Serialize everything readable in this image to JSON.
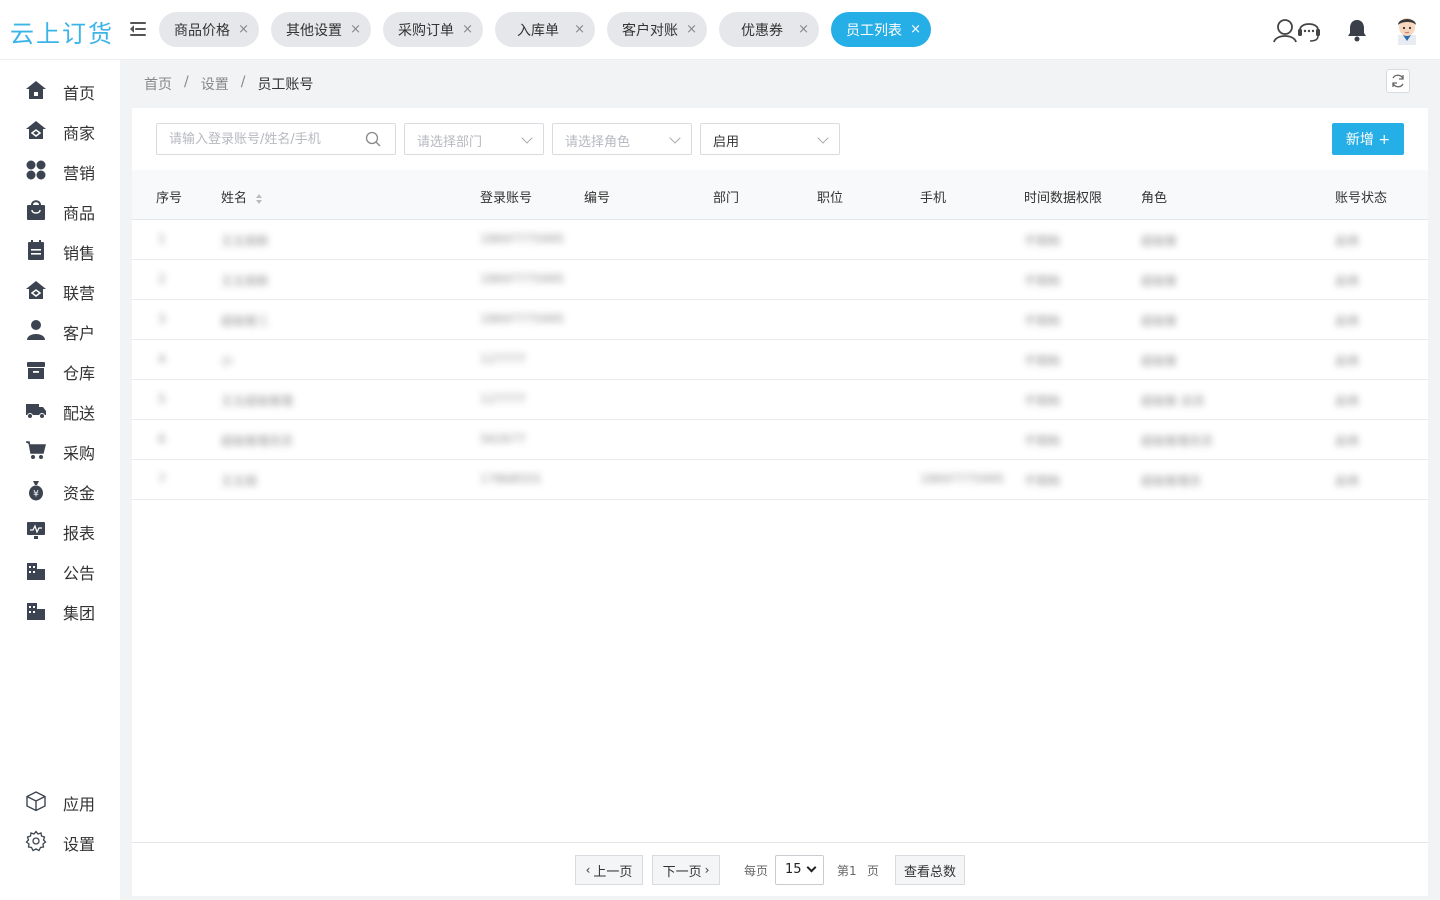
{
  "app": {
    "logo": "云上订货"
  },
  "tabs": [
    {
      "label": "商品价格",
      "close": "×",
      "active": false
    },
    {
      "label": "其他设置",
      "close": "×",
      "active": false
    },
    {
      "label": "采购订单",
      "close": "×",
      "active": false
    },
    {
      "label": "入库单",
      "close": "×",
      "active": false
    },
    {
      "label": "客户对账",
      "close": "×",
      "active": false
    },
    {
      "label": "优惠券",
      "close": "×",
      "active": false
    },
    {
      "label": "员工列表",
      "close": "×",
      "active": true
    }
  ],
  "header_icons": [
    "customer-service-icon",
    "bell-icon",
    "avatar"
  ],
  "sidebar": {
    "items": [
      {
        "label": "首页",
        "icon": "home-icon"
      },
      {
        "label": "商家",
        "icon": "store-icon"
      },
      {
        "label": "营销",
        "icon": "marketing-icon"
      },
      {
        "label": "商品",
        "icon": "goods-bag-icon"
      },
      {
        "label": "销售",
        "icon": "sales-calendar-icon"
      },
      {
        "label": "联营",
        "icon": "alliance-icon"
      },
      {
        "label": "客户",
        "icon": "customer-icon"
      },
      {
        "label": "仓库",
        "icon": "warehouse-icon"
      },
      {
        "label": "配送",
        "icon": "truck-icon"
      },
      {
        "label": "采购",
        "icon": "cart-icon"
      },
      {
        "label": "资金",
        "icon": "money-bag-icon"
      },
      {
        "label": "报表",
        "icon": "report-icon"
      },
      {
        "label": "公告",
        "icon": "announcement-icon"
      },
      {
        "label": "集团",
        "icon": "group-building-icon"
      }
    ],
    "bottom": [
      {
        "label": "应用",
        "icon": "cube-icon"
      },
      {
        "label": "设置",
        "icon": "gear-icon"
      }
    ]
  },
  "breadcrumb": {
    "home": "首页",
    "sep": "/",
    "level2": "设置",
    "current": "员工账号"
  },
  "filters": {
    "search_placeholder": "请输入登录账号/姓名/手机",
    "department_placeholder": "请选择部门",
    "role_placeholder": "请选择角色",
    "status_value": "启用"
  },
  "add_button": "新增 +",
  "table": {
    "headers": {
      "index": "序号",
      "name": "姓名",
      "account": "登录账号",
      "code": "编号",
      "department": "部门",
      "position": "职位",
      "phone": "手机",
      "time_permission": "时间数据权限",
      "role": "角色",
      "status": "账号状态"
    },
    "rows": [
      {
        "index": "1",
        "name": "王五丽新",
        "account": "18697775995",
        "code": "",
        "department": "",
        "position": "",
        "phone": "",
        "time_permission": "不限制",
        "role": "超级管",
        "status": "启用"
      },
      {
        "index": "2",
        "name": "王五丽新",
        "account": "18697775995",
        "code": "",
        "department": "",
        "position": "",
        "phone": "",
        "time_permission": "不限制",
        "role": "超级管",
        "status": "启用"
      },
      {
        "index": "3",
        "name": "超级管三",
        "account": "18697775995",
        "code": "",
        "department": "",
        "position": "",
        "phone": "",
        "time_permission": "不限制",
        "role": "超级管",
        "status": "启用"
      },
      {
        "index": "4",
        "name": "小",
        "account": "127777",
        "code": "",
        "department": "",
        "position": "",
        "phone": "",
        "time_permission": "不限制",
        "role": "超级管",
        "status": "启用"
      },
      {
        "index": "5",
        "name": "王五超级管理",
        "account": "127777",
        "code": "",
        "department": "",
        "position": "",
        "phone": "",
        "time_permission": "不限制",
        "role": "超级管 店员",
        "status": "启用"
      },
      {
        "index": "6",
        "name": "超级管理员员",
        "account": "562677",
        "code": "",
        "department": "",
        "position": "",
        "phone": "",
        "time_permission": "不限制",
        "role": "超级管理员员",
        "status": "启用"
      },
      {
        "index": "7",
        "name": "王五丽",
        "account": "17868555",
        "code": "",
        "department": "",
        "position": "",
        "phone": "18697775995",
        "time_permission": "不限制",
        "role": "超级管理员",
        "status": "启用"
      }
    ]
  },
  "pager": {
    "prev": "上一页",
    "next": "下一页",
    "per_page_label": "每页",
    "per_page_value": "15",
    "page_label": "第1",
    "page_unit": "页",
    "total_button": "查看总数"
  }
}
